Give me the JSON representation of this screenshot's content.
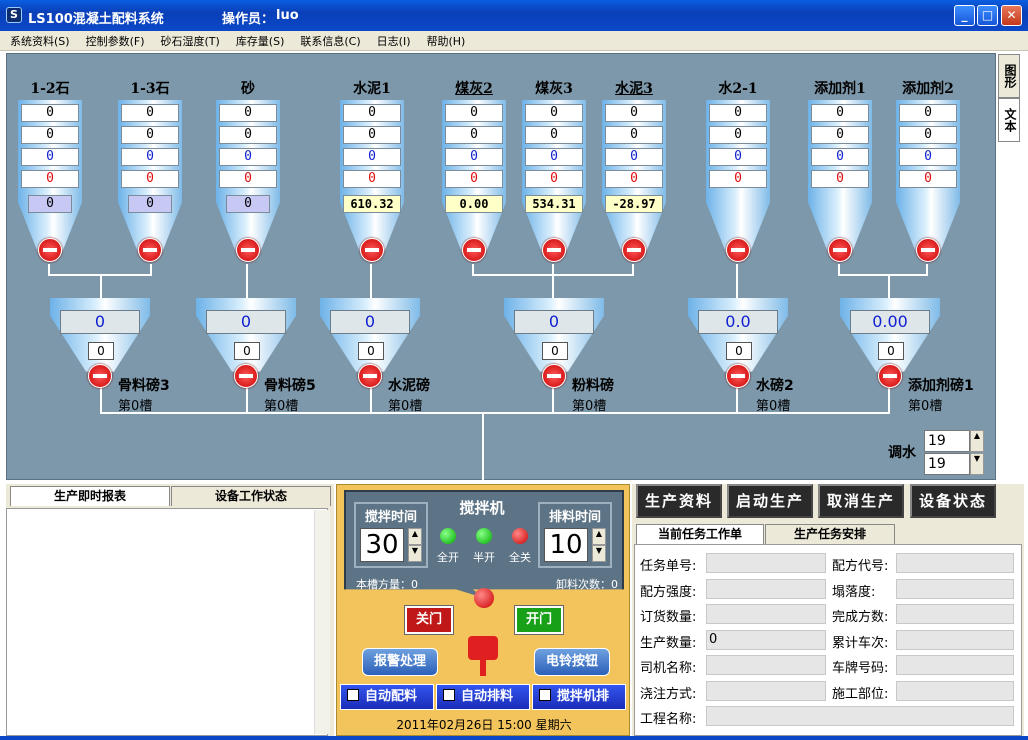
{
  "window": {
    "title": "LS100混凝土配料系统",
    "operator_label": "操作员：",
    "operator": "luo"
  },
  "menu": [
    "系统资料(S)",
    "控制参数(F)",
    "砂石湿度(T)",
    "库存量(S)",
    "联系信息(C)",
    "日志(I)",
    "帮助(H)"
  ],
  "side_tabs": {
    "graphic": "图形",
    "text": "文本"
  },
  "silos": [
    {
      "label": "1-2石",
      "v": [
        "0",
        "0",
        "0",
        "0"
      ],
      "weigh": "0",
      "underline": false
    },
    {
      "label": "1-3石",
      "v": [
        "0",
        "0",
        "0",
        "0"
      ],
      "weigh": "0",
      "underline": false
    },
    {
      "label": "砂",
      "v": [
        "0",
        "0",
        "0",
        "0"
      ],
      "weigh": "0",
      "underline": false
    },
    {
      "label": "水泥1",
      "v": [
        "0",
        "0",
        "0",
        "0"
      ],
      "weigh": "610.32",
      "underline": false
    },
    {
      "label": "煤灰2",
      "v": [
        "0",
        "0",
        "0",
        "0"
      ],
      "weigh": "0.00",
      "underline": true
    },
    {
      "label": "煤灰3",
      "v": [
        "0",
        "0",
        "0",
        "0"
      ],
      "weigh": "534.31",
      "underline": false
    },
    {
      "label": "水泥3",
      "v": [
        "0",
        "0",
        "0",
        "0"
      ],
      "weigh": "-28.97",
      "underline": true
    },
    {
      "label": "水2-1",
      "v": [
        "0",
        "0",
        "0",
        "0"
      ],
      "weigh": "",
      "underline": false
    },
    {
      "label": "添加剂1",
      "v": [
        "0",
        "0",
        "0",
        "0"
      ],
      "weigh": "",
      "underline": false
    },
    {
      "label": "添加剂2",
      "v": [
        "0",
        "0",
        "0",
        "0"
      ],
      "weigh": "",
      "underline": false
    }
  ],
  "scales": [
    {
      "name": "骨料磅3",
      "value": "0",
      "small": "0",
      "slot": "第0槽"
    },
    {
      "name": "骨料磅5",
      "value": "0",
      "small": "0",
      "slot": "第0槽"
    },
    {
      "name": "水泥磅",
      "value": "0",
      "small": "0",
      "slot": "第0槽"
    },
    {
      "name": "粉料磅",
      "value": "0",
      "small": "0",
      "slot": "第0槽"
    },
    {
      "name": "水磅2",
      "value": "0.0",
      "small": "0",
      "slot": "第0槽"
    },
    {
      "name": "添加剂磅1",
      "value": "0.00",
      "small": "0",
      "slot": "第0槽"
    }
  ],
  "water_adjust": {
    "label": "调水",
    "value1": "19",
    "value2": "19"
  },
  "bottom_left": {
    "tabs": [
      "生产即时报表",
      "设备工作状态"
    ]
  },
  "mixer": {
    "title": "搅拌机",
    "stir_label": "搅拌时间",
    "stir_value": "30",
    "discharge_label": "排料时间",
    "discharge_value": "10",
    "leds": [
      "全开",
      "半开",
      "全关"
    ],
    "volume_label": "本槽方量：0",
    "unload_label": "卸料次数：0"
  },
  "controls": {
    "close_door": "关门",
    "open_door": "开门",
    "alarm": "报警处理",
    "bell": "电铃按钮",
    "auto_batch": "自动配料",
    "auto_discharge": "自动排料",
    "mixer_discharge": "搅拌机排",
    "datetime": "2011年02月26日  15:00  星期六"
  },
  "actions": [
    "生产资料",
    "启动生产",
    "取消生产",
    "设备状态"
  ],
  "task_tabs": [
    "当前任务工作单",
    "生产任务安排"
  ],
  "task_fields": [
    {
      "label": "任务单号:",
      "value": ""
    },
    {
      "label": "配方代号:",
      "value": ""
    },
    {
      "label": "配方强度:",
      "value": ""
    },
    {
      "label": "塌落度:",
      "value": ""
    },
    {
      "label": "订货数量:",
      "value": ""
    },
    {
      "label": "完成方数:",
      "value": ""
    },
    {
      "label": "生产数量:",
      "value": "0"
    },
    {
      "label": "累计车次:",
      "value": ""
    },
    {
      "label": "司机名称:",
      "value": ""
    },
    {
      "label": "车牌号码:",
      "value": ""
    },
    {
      "label": "浇注方式:",
      "value": ""
    },
    {
      "label": "施工部位:",
      "value": ""
    },
    {
      "label": "工程名称:",
      "value": ""
    }
  ]
}
